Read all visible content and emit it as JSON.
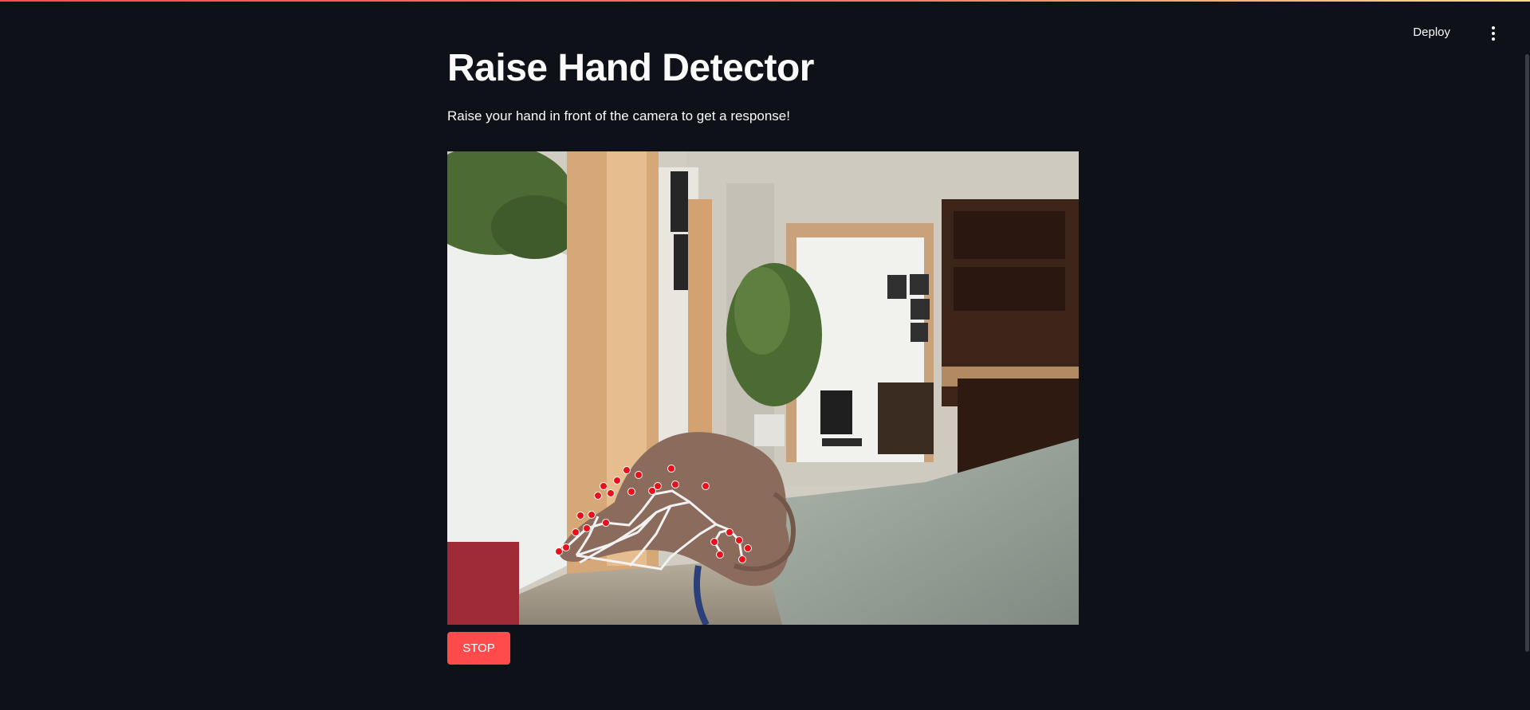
{
  "header": {
    "deploy_label": "Deploy",
    "menu_icon": "vertical-ellipsis-icon"
  },
  "main": {
    "title": "Raise Hand Detector",
    "subtitle": "Raise your hand in front of the camera to get a response!",
    "video": {
      "description_icon": "webcam-feed"
    },
    "stop_label": "STOP"
  },
  "colors": {
    "background": "#0e1117",
    "text": "#fafafa",
    "accent": "#ff4b4b",
    "landmark_point": "#e8101a",
    "landmark_line": "#f2f2f2"
  }
}
